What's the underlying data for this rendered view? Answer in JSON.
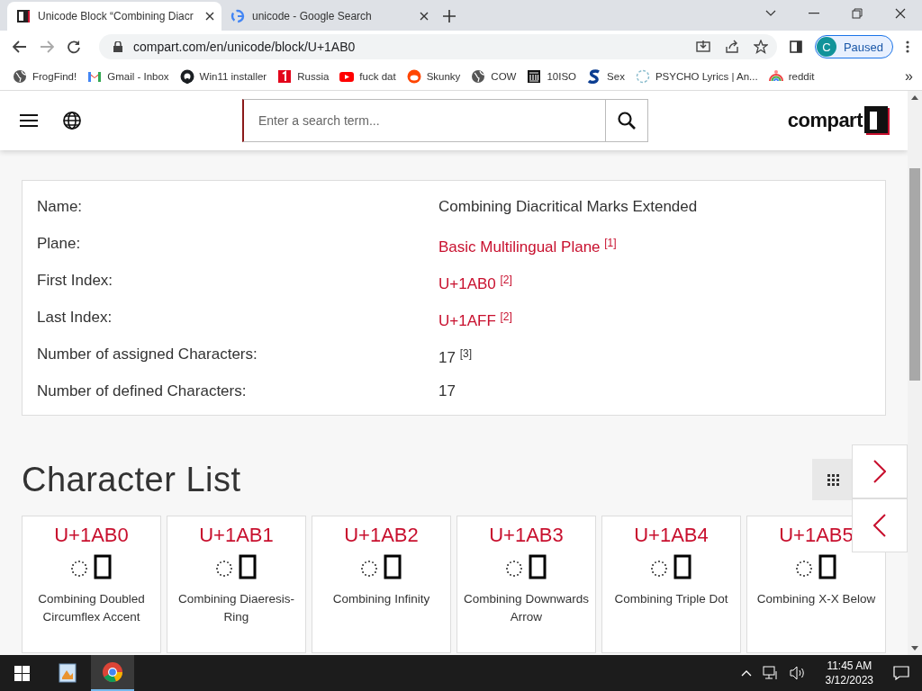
{
  "browser": {
    "tabs": [
      {
        "title": "Unicode Block “Combining Diacr",
        "selected": true
      },
      {
        "title": "unicode - Google Search",
        "selected": false
      }
    ],
    "address": "compart.com/en/unicode/block/U+1AB0",
    "profile": {
      "initial": "C",
      "label": "Paused"
    },
    "bookmarks": [
      {
        "label": "FrogFind!"
      },
      {
        "label": "Gmail - Inbox"
      },
      {
        "label": "Win11 installer"
      },
      {
        "label": "Russia"
      },
      {
        "label": "fuck dat"
      },
      {
        "label": "Skunky"
      },
      {
        "label": "COW"
      },
      {
        "label": "10ISO"
      },
      {
        "label": "Sex"
      },
      {
        "label": "PSYCHO Lyrics | An..."
      },
      {
        "label": "reddit"
      }
    ],
    "more_bookmarks": "»"
  },
  "site": {
    "search": {
      "placeholder": "Enter a search term..."
    },
    "logo": "compart"
  },
  "info": [
    {
      "label": "Name:",
      "value": "Combining Diacritical Marks Extended",
      "link": false
    },
    {
      "label": "Plane:",
      "value": "Basic Multilingual Plane $^{[1]}$",
      "link": true
    },
    {
      "label": "First Index:",
      "value": "U+1AB0 $^{[2]}$",
      "link": true
    },
    {
      "label": "Last Index:",
      "value": "U+1AFF $^{[2]}$",
      "link": true
    },
    {
      "label": "Number of assigned Characters:",
      "value": "17 $^{[3]}$",
      "link": false
    },
    {
      "label": "Number of defined Characters:",
      "value": "17",
      "link": false
    }
  ],
  "character_list": {
    "heading": "Character List",
    "cards": [
      {
        "code": "U+1AB0",
        "name": "Combining Doubled Circumflex Accent"
      },
      {
        "code": "U+1AB1",
        "name": "Combining Diaeresis-Ring"
      },
      {
        "code": "U+1AB2",
        "name": "Combining Infinity"
      },
      {
        "code": "U+1AB3",
        "name": "Combining Downwards Arrow"
      },
      {
        "code": "U+1AB4",
        "name": "Combining Triple Dot"
      },
      {
        "code": "U+1AB5",
        "name": "Combining X-X Below"
      }
    ]
  },
  "taskbar": {
    "time": "11:45 AM",
    "date": "3/12/2023"
  }
}
